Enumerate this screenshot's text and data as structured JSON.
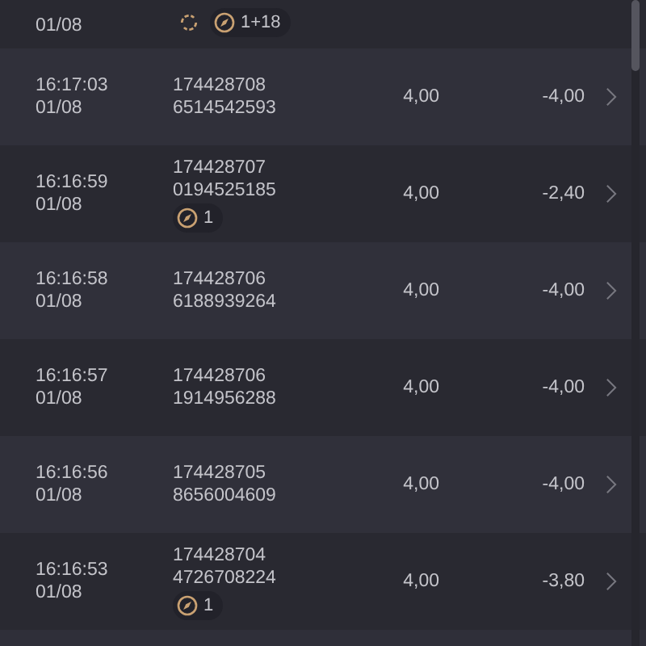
{
  "rows": [
    {
      "date": "01/08",
      "badges": [
        {
          "kind": "sync"
        },
        {
          "kind": "tag",
          "count": "1+18"
        }
      ]
    },
    {
      "time": "16:17:03",
      "date": "01/08",
      "ids": [
        "174428708",
        "6514542593"
      ],
      "quantity": "4,00",
      "amount": "-4,00"
    },
    {
      "time": "16:16:59",
      "date": "01/08",
      "ids": [
        "174428707",
        "0194525185"
      ],
      "badges": [
        {
          "kind": "tag",
          "count": "1"
        }
      ],
      "quantity": "4,00",
      "amount": "-2,40"
    },
    {
      "time": "16:16:58",
      "date": "01/08",
      "ids": [
        "174428706",
        "6188939264"
      ],
      "quantity": "4,00",
      "amount": "-4,00"
    },
    {
      "time": "16:16:57",
      "date": "01/08",
      "ids": [
        "174428706",
        "1914956288"
      ],
      "quantity": "4,00",
      "amount": "-4,00"
    },
    {
      "time": "16:16:56",
      "date": "01/08",
      "ids": [
        "174428705",
        "8656004609"
      ],
      "quantity": "4,00",
      "amount": "-4,00"
    },
    {
      "time": "16:16:53",
      "date": "01/08",
      "ids": [
        "174428704",
        "4726708224"
      ],
      "badges": [
        {
          "kind": "tag",
          "count": "1"
        }
      ],
      "quantity": "4,00",
      "amount": "-3,80"
    }
  ]
}
